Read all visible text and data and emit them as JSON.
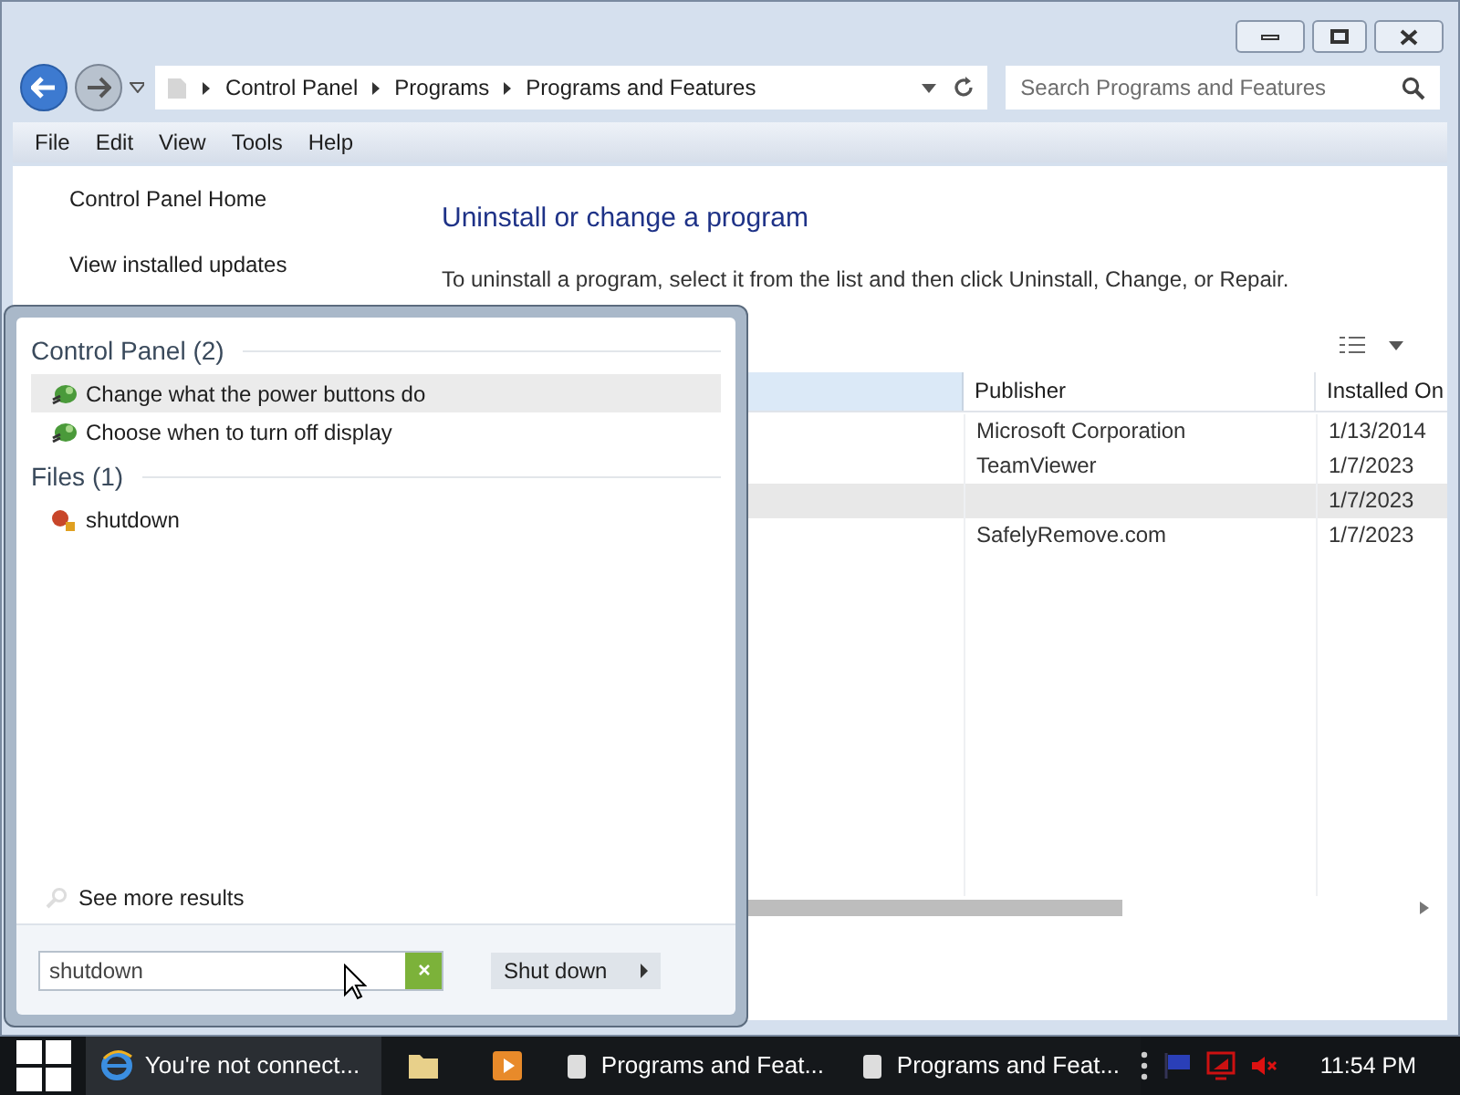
{
  "nav": {
    "breadcrumbs": [
      "Control Panel",
      "Programs",
      "Programs and Features"
    ],
    "search_placeholder": "Search Programs and Features"
  },
  "menu": [
    "File",
    "Edit",
    "View",
    "Tools",
    "Help"
  ],
  "sidebar": [
    "Control Panel Home",
    "View installed updates"
  ],
  "main": {
    "heading": "Uninstall or change a program",
    "description": "To uninstall a program, select it from the list and then click Uninstall, Change, or Repair."
  },
  "table": {
    "columns": [
      "Publisher",
      "Installed On"
    ],
    "rows": [
      {
        "publisher": "Microsoft Corporation",
        "installed_on": "1/13/2014",
        "selected": false
      },
      {
        "publisher": "TeamViewer",
        "installed_on": "1/7/2023",
        "selected": false
      },
      {
        "publisher": "",
        "installed_on": "1/7/2023",
        "selected": true
      },
      {
        "publisher": "SafelyRemove.com",
        "installed_on": "1/7/2023",
        "selected": false
      }
    ]
  },
  "start_menu": {
    "groups": [
      {
        "title": "Control Panel (2)",
        "items": [
          {
            "label": "Change what the power buttons do",
            "kind": "power",
            "selected": true
          },
          {
            "label": "Choose when to turn off display",
            "kind": "power",
            "selected": false
          }
        ]
      },
      {
        "title": "Files (1)",
        "items": [
          {
            "label": "shutdown",
            "kind": "file",
            "selected": false
          }
        ]
      }
    ],
    "see_more": "See more results",
    "search_value": "shutdown",
    "shutdown_button": "Shut down"
  },
  "taskbar": {
    "items": [
      {
        "kind": "browser",
        "label": "You're not connect...",
        "active": true
      },
      {
        "kind": "folder",
        "active": false
      },
      {
        "kind": "media",
        "active": false
      },
      {
        "kind": "window",
        "label": "Programs and Feat...",
        "active": false
      },
      {
        "kind": "window",
        "label": "Programs and Feat...",
        "active": false
      }
    ],
    "clock": "11:54 PM"
  }
}
